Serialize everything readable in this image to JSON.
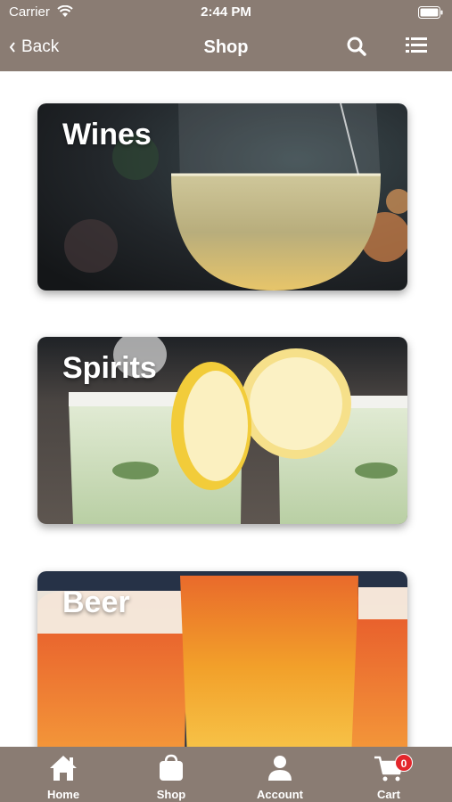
{
  "status_bar": {
    "carrier": "Carrier",
    "time": "2:44 PM"
  },
  "nav": {
    "back_label": "Back",
    "title": "Shop"
  },
  "categories": [
    {
      "label": "Wines"
    },
    {
      "label": "Spirits"
    },
    {
      "label": "Beer"
    }
  ],
  "tabs": [
    {
      "label": "Home",
      "icon": "home-icon"
    },
    {
      "label": "Shop",
      "icon": "shopping-bag-icon"
    },
    {
      "label": "Account",
      "icon": "person-icon"
    },
    {
      "label": "Cart",
      "icon": "cart-icon",
      "badge": "0"
    }
  ],
  "colors": {
    "bar": "#8a7c73",
    "badge": "#e3262b"
  }
}
